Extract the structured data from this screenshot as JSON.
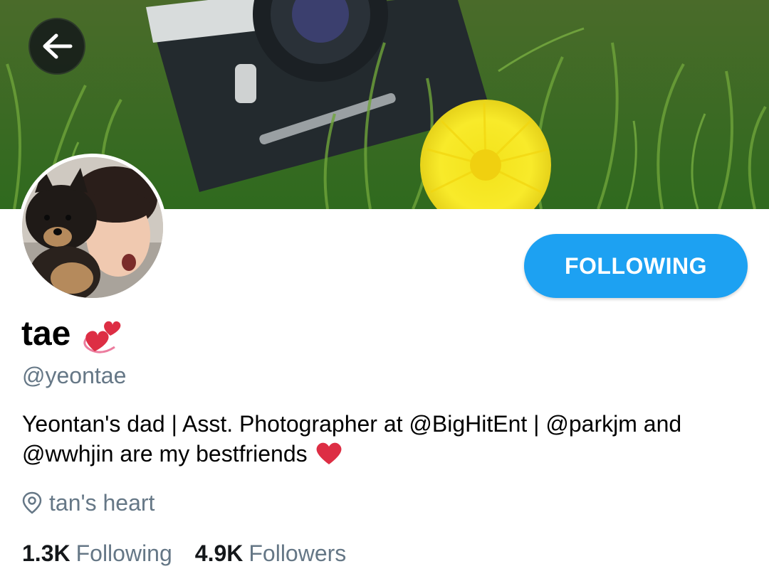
{
  "profile": {
    "display_name": "tae",
    "name_emoji": "revolving-hearts-icon",
    "handle": "@yeontae",
    "bio": {
      "line1": "Yeontan's dad | Asst. Photographer at @BigHitEnt | @parkjm and",
      "line2": "@wwhjin are my bestfriends",
      "trailing_emoji": "red-heart-icon"
    },
    "location": "tan's heart",
    "location_icon": "location-pin-icon"
  },
  "actions": {
    "follow_label": "FOLLOWING",
    "back_icon": "back-arrow-icon"
  },
  "stats": {
    "following_count": "1.3K",
    "following_label": "Following",
    "followers_count": "4.9K",
    "followers_label": "Followers"
  },
  "colors": {
    "accent": "#1da1f2",
    "secondary_text": "#657786",
    "heart": "#e0245e"
  }
}
